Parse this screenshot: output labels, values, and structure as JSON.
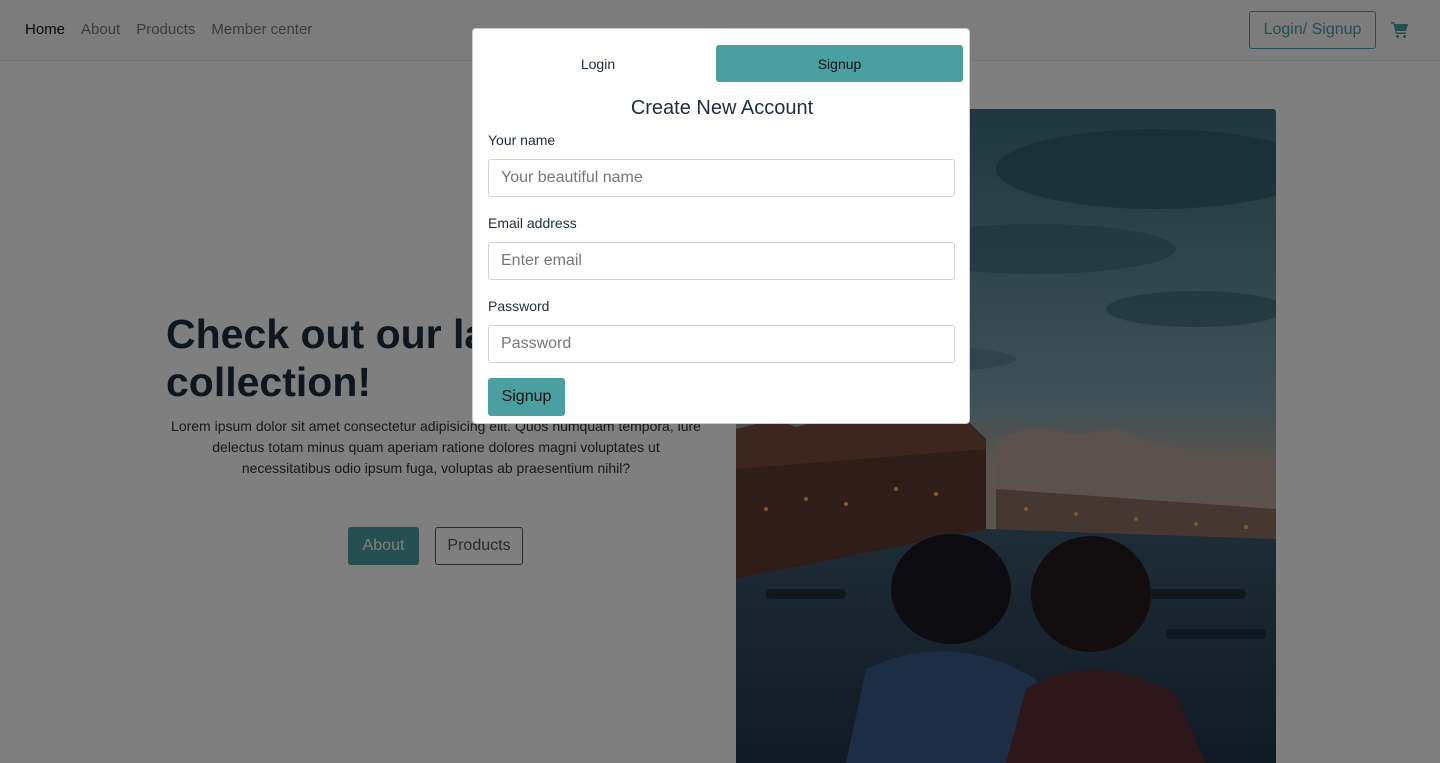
{
  "navbar": {
    "links": [
      "Home",
      "About",
      "Products",
      "Member center"
    ],
    "login_label": "Login/ Signup",
    "cart_icon": "cart-icon"
  },
  "hero": {
    "title": "Check out our latest collection!",
    "text": "Lorem ipsum dolor sit amet consectetur adipisicing elit. Quos numquam tempora, iure delectus totam minus quam aperiam ratione dolores magni voluptates ut necessitatibus odio ipsum fuga, voluptas ab praesentium nihil?",
    "about_label": "About",
    "products_label": "Products"
  },
  "modal": {
    "tab_login": "Login",
    "tab_signup": "Signup",
    "title": "Create New Account",
    "name_label": "Your name",
    "name_placeholder": "Your beautiful name",
    "email_label": "Email address",
    "email_placeholder": "Enter email",
    "password_label": "Password",
    "password_placeholder": "Password",
    "submit_label": "Signup"
  },
  "colors": {
    "accent": "#4a9fa0",
    "overlay": "rgba(0,0,0,0.5)",
    "text_dark": "#1f2d3d"
  }
}
